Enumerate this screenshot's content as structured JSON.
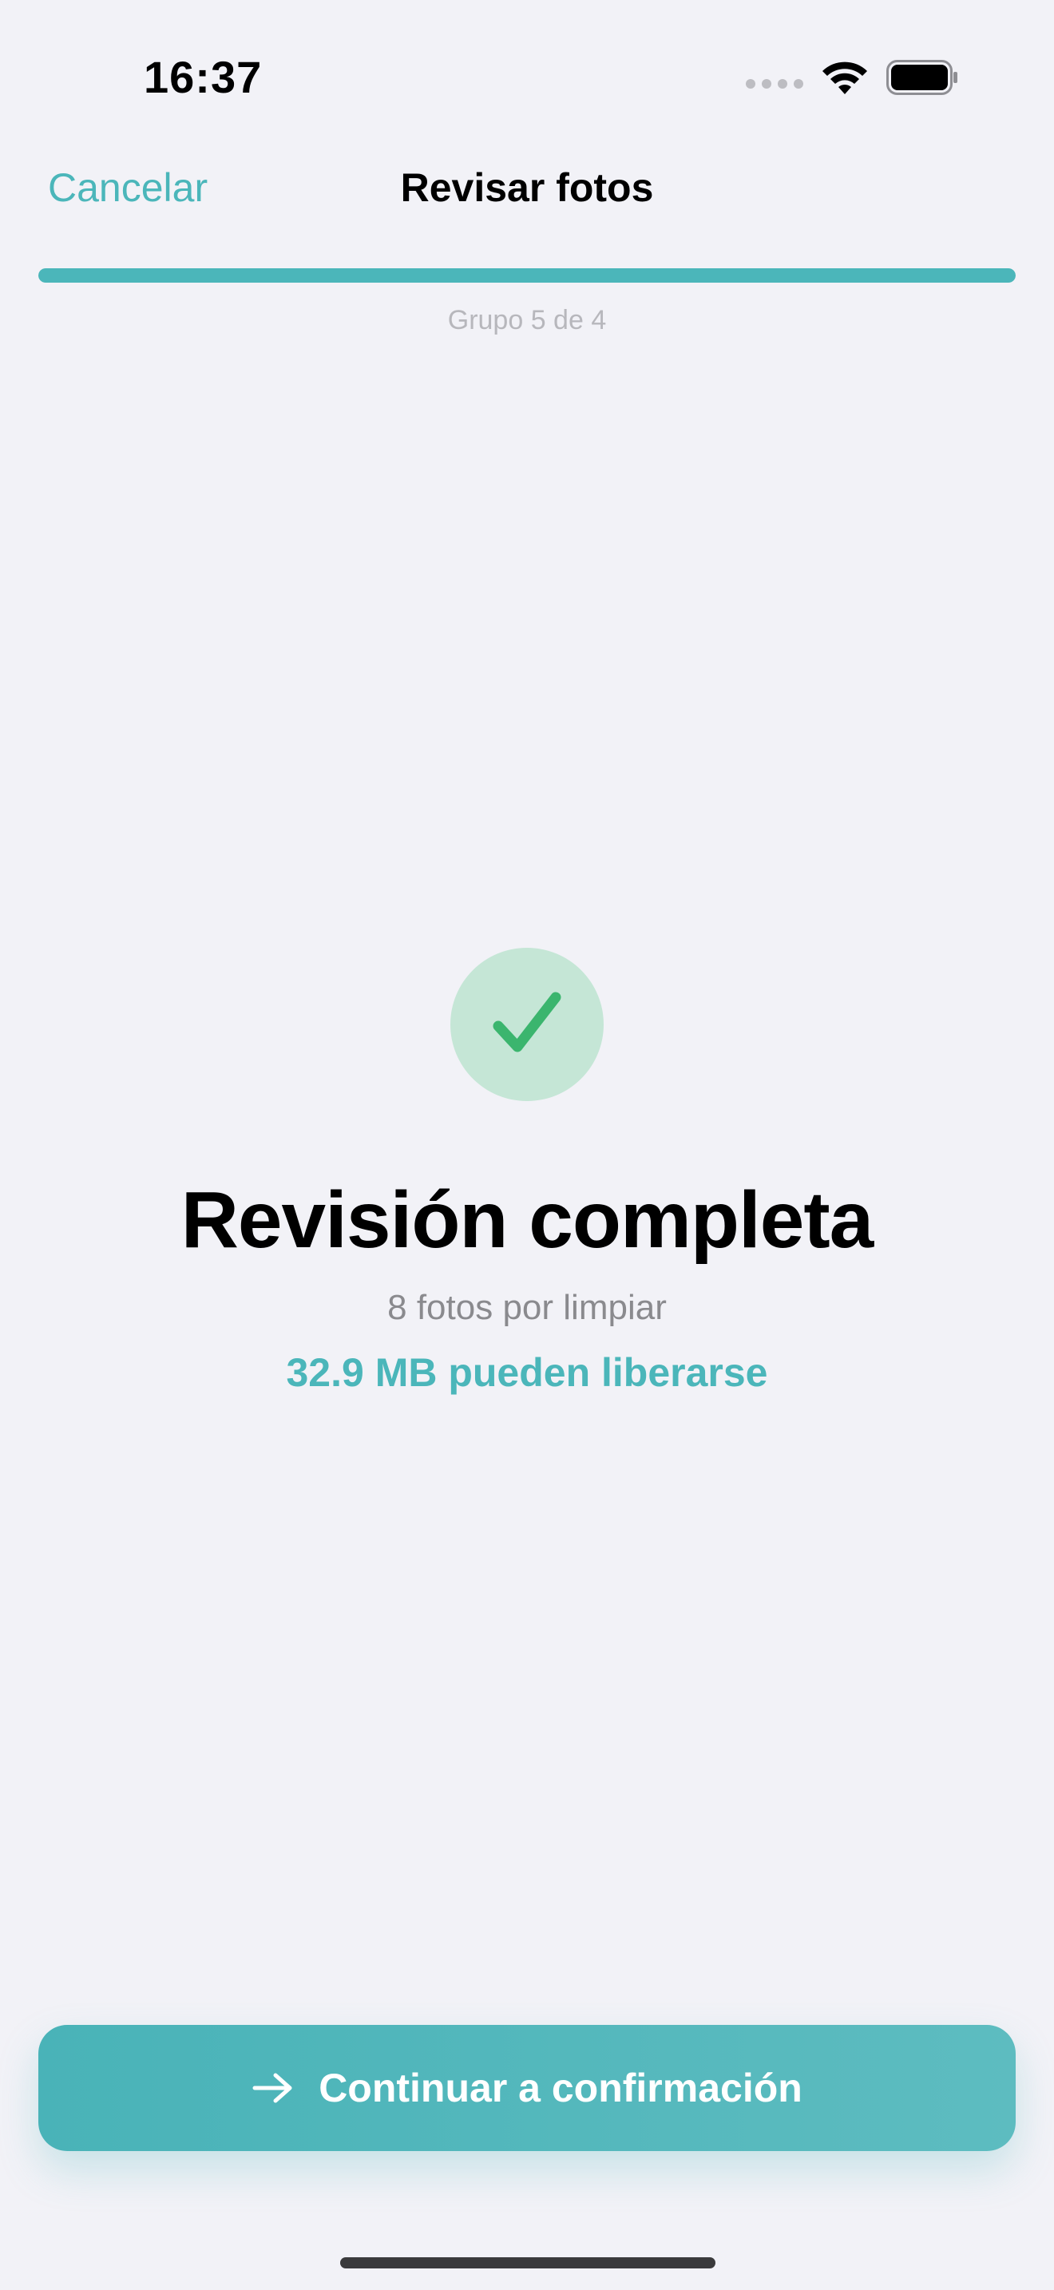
{
  "status_bar": {
    "time": "16:37"
  },
  "nav": {
    "cancel_label": "Cancelar",
    "title": "Revisar fotos"
  },
  "progress": {
    "fraction": 1.0,
    "group_label": "Grupo 5 de 4"
  },
  "result": {
    "headline": "Revisión completa",
    "photos_text": "8 fotos por limpiar",
    "savings_text": "32.9 MB pueden liberarse"
  },
  "continue_button": {
    "label": "Continuar a confirmación"
  },
  "colors": {
    "accent": "#4BB6BA",
    "success": "#3BB56E",
    "success_bg": "#C5E6D6",
    "background": "#F2F2F7"
  },
  "icons": {
    "check": "checkmark-icon",
    "arrow": "arrow-right-icon",
    "wifi": "wifi-icon",
    "battery": "battery-icon",
    "signal": "signal-icon"
  }
}
